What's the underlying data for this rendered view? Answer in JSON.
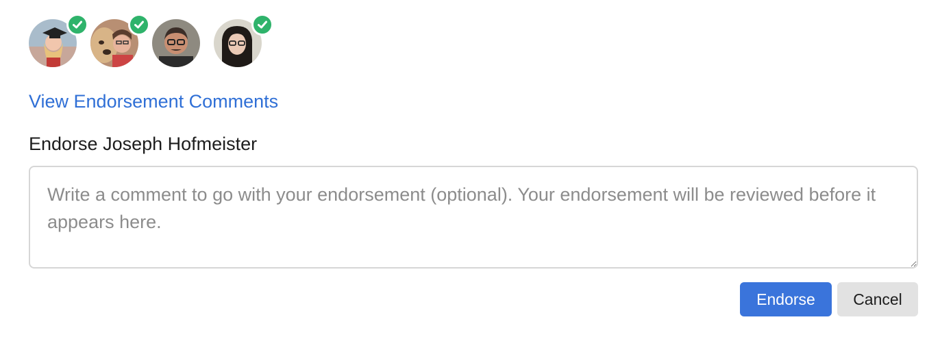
{
  "endorsers": [
    {
      "name_hint": "graduate-in-cap",
      "endorsed": true
    },
    {
      "name_hint": "person-with-dog",
      "endorsed": true
    },
    {
      "name_hint": "man-with-glasses",
      "endorsed": false
    },
    {
      "name_hint": "woman-with-glasses",
      "endorsed": true
    }
  ],
  "view_comments_link": "View Endorsement Comments",
  "form": {
    "label": "Endorse Joseph Hofmeister",
    "comment_value": "",
    "comment_placeholder": "Write a comment to go with your endorsement (optional). Your endorsement will be reviewed before it appears here."
  },
  "buttons": {
    "endorse_label": "Endorse",
    "cancel_label": "Cancel"
  },
  "colors": {
    "link": "#2f6fd6",
    "primary_button": "#3a74db",
    "secondary_button": "#e2e2e2",
    "check_badge": "#2fb36b",
    "input_border": "#d6d6d6"
  }
}
